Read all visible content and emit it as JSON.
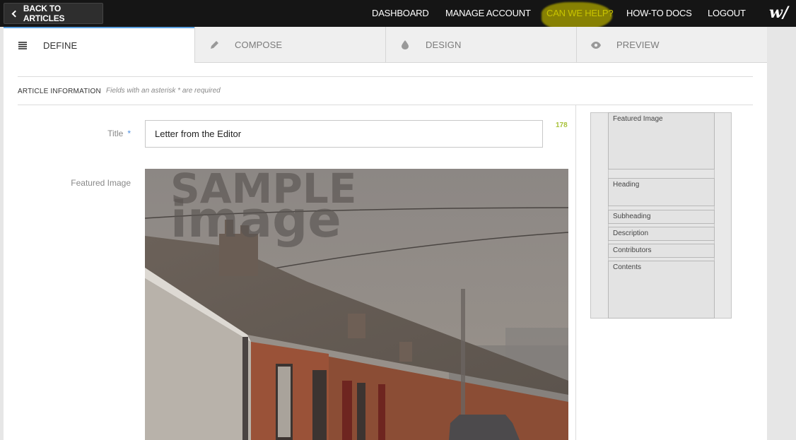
{
  "topbar": {
    "back_label": "BACK TO ARTICLES",
    "nav": [
      "DASHBOARD",
      "MANAGE ACCOUNT",
      "CAN WE HELP?",
      "HOW-TO DOCS",
      "LOGOUT"
    ],
    "logo_text": "w/"
  },
  "tabs": [
    {
      "label": "DEFINE",
      "icon": "list-icon",
      "active": true
    },
    {
      "label": "COMPOSE",
      "icon": "pencil-icon",
      "active": false
    },
    {
      "label": "DESIGN",
      "icon": "droplet-icon",
      "active": false
    },
    {
      "label": "PREVIEW",
      "icon": "eye-icon",
      "active": false
    }
  ],
  "section": {
    "title": "ARTICLE INFORMATION",
    "note": "Fields with an asterisk * are required"
  },
  "form": {
    "title_label": "Title",
    "required_marker": "*",
    "title_value": "Letter from the Editor",
    "char_count": "178",
    "featured_label": "Featured Image",
    "image_watermark_line1": "SAMPLE",
    "image_watermark_line2": "image"
  },
  "layout_panel": {
    "blocks": [
      "Featured Image",
      "Heading",
      "Subheading",
      "Description",
      "Contributors",
      "Contents"
    ]
  },
  "colors": {
    "accent": "#5aa0e0",
    "help_highlight": "#c9c400",
    "char_count": "#a8c23a"
  }
}
